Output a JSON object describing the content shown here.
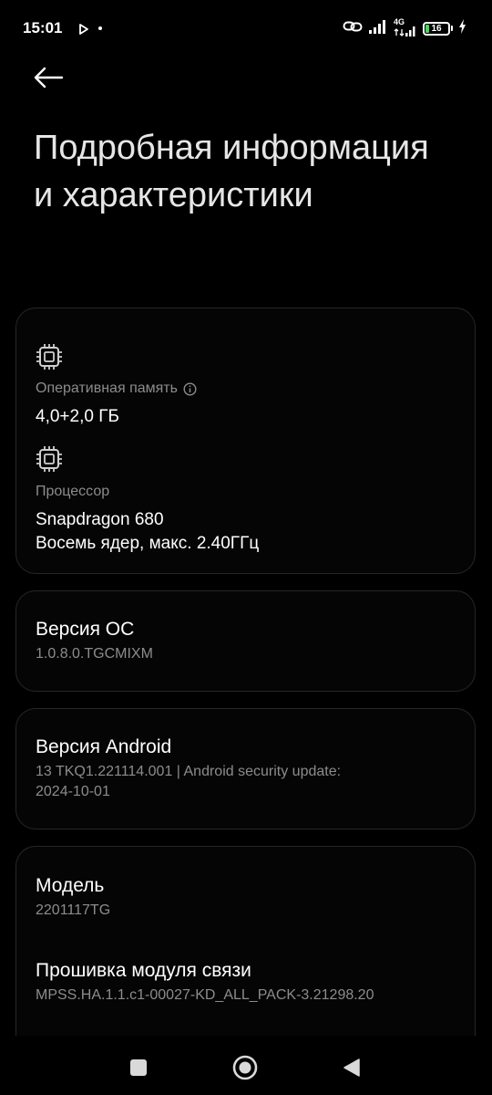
{
  "status_bar": {
    "time": "15:01",
    "network_type": "4G",
    "battery_level": "16",
    "battery_fraction": 0.16,
    "icons": [
      "play-icon",
      "link-icon",
      "signal-icon",
      "signal-icon",
      "battery-icon",
      "charging-icon"
    ]
  },
  "header": {
    "back_icon": "arrow-left-icon",
    "title": "Подробная информация и характеристики"
  },
  "hardware": {
    "ram": {
      "icon": "chip-icon",
      "label": "Оперативная память",
      "info_icon": "info-icon",
      "value": "4,0+2,0 ГБ"
    },
    "cpu": {
      "icon": "chip-icon",
      "label": "Процессор",
      "value_line1": "Snapdragon 680",
      "value_line2": "Восемь ядер, макс. 2.40ГГц"
    }
  },
  "os_version": {
    "title": "Версия ОС",
    "value": "1.0.8.0.TGCMIXM"
  },
  "android_version": {
    "title": "Версия Android",
    "value_line1": "13 TKQ1.221114.001 | Android security update:",
    "value_line2": "2024-10-01"
  },
  "model": {
    "title": "Модель",
    "value": "2201117TG"
  },
  "baseband": {
    "title": "Прошивка модуля связи",
    "value": "MPSS.HA.1.1.c1-00027-KD_ALL_PACK-3.21298.20"
  },
  "nav_bar": {
    "icons": [
      "recents-square-icon",
      "home-circle-icon",
      "back-triangle-icon"
    ]
  },
  "colors": {
    "background": "#000000",
    "card_border": "#262626",
    "secondary_text": "#8c8c8c",
    "battery_fill": "#3ddc5b"
  }
}
